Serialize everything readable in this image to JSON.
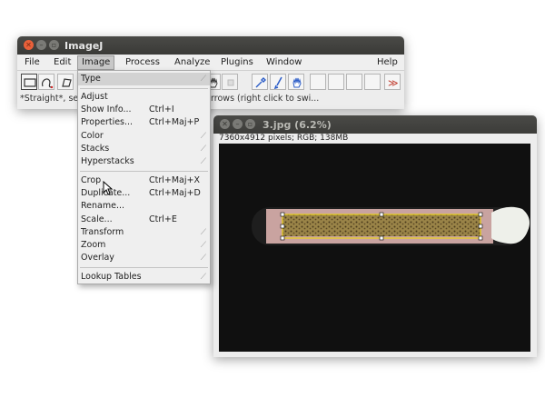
{
  "main_window": {
    "title": "ImageJ",
    "menus": [
      "File",
      "Edit",
      "Image",
      "Process",
      "Analyze",
      "Plugins",
      "Window",
      "Help"
    ],
    "status": "*Straight*, se",
    "status_tail": "arrows (right click to swi..."
  },
  "dropdown": {
    "items": [
      {
        "label": "Type",
        "shortcut": "",
        "submenu": true
      },
      {
        "label": "Adjust",
        "shortcut": "",
        "submenu": false
      },
      {
        "label": "Show Info...",
        "shortcut": "Ctrl+I",
        "submenu": false
      },
      {
        "label": "Properties...",
        "shortcut": "Ctrl+Maj+P",
        "submenu": false
      },
      {
        "label": "Color",
        "shortcut": "",
        "submenu": true
      },
      {
        "label": "Stacks",
        "shortcut": "",
        "submenu": true
      },
      {
        "label": "Hyperstacks",
        "shortcut": "",
        "submenu": true
      },
      {
        "label": "Crop",
        "shortcut": "Ctrl+Maj+X",
        "submenu": false
      },
      {
        "label": "Duplicate...",
        "shortcut": "Ctrl+Maj+D",
        "submenu": false
      },
      {
        "label": "Rename...",
        "shortcut": "",
        "submenu": false
      },
      {
        "label": "Scale...",
        "shortcut": "Ctrl+E",
        "submenu": false
      },
      {
        "label": "Transform",
        "shortcut": "",
        "submenu": true
      },
      {
        "label": "Zoom",
        "shortcut": "",
        "submenu": true
      },
      {
        "label": "Overlay",
        "shortcut": "",
        "submenu": true
      },
      {
        "label": "Lookup Tables",
        "shortcut": "",
        "submenu": true
      }
    ]
  },
  "image_window": {
    "title": "3.jpg (6.2%)",
    "info": "7360x4912 pixels; RGB; 138MB"
  },
  "colors": {
    "titlebar": "#3c3c39",
    "close_button": "#e9603a",
    "selection": "#e8d21a",
    "canvas": "#101010"
  }
}
